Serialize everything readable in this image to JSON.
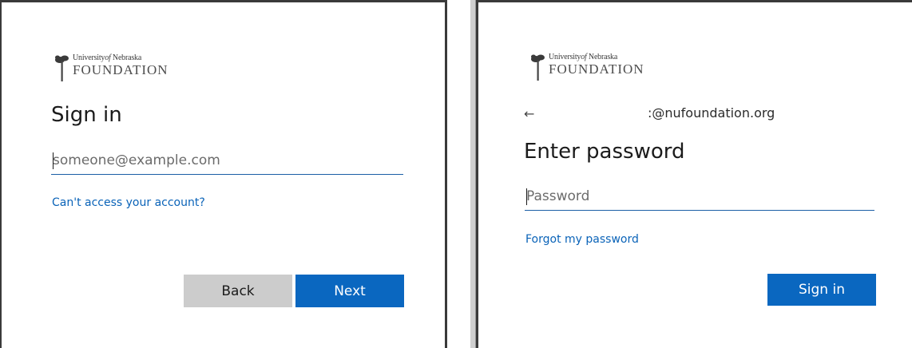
{
  "left_panel": {
    "logo": {
      "line1_a": "University",
      "line1_of": "of",
      "line1_b": "Nebraska",
      "line2": "FOUNDATION",
      "icon": "tree-logo-icon"
    },
    "title": "Sign in",
    "email_input": {
      "placeholder": "someone@example.com",
      "value": ""
    },
    "cant_access_link": "Can't access your account?",
    "back_button": "Back",
    "next_button": "Next"
  },
  "right_panel": {
    "logo": {
      "line1_a": "University",
      "line1_of": "of",
      "line1_b": "Nebraska",
      "line2": "FOUNDATION",
      "icon": "tree-logo-icon"
    },
    "back_arrow": "←",
    "account_email": ":@nufoundation.org",
    "title": "Enter password",
    "password_input": {
      "placeholder": "Password",
      "value": ""
    },
    "forgot_link": "Forgot my password",
    "sign_in_button": "Sign in"
  },
  "colors": {
    "primary_button": "#0a67c0",
    "secondary_button": "#cccccc",
    "link": "#0a63b8",
    "input_underline": "#1b5fa6"
  }
}
